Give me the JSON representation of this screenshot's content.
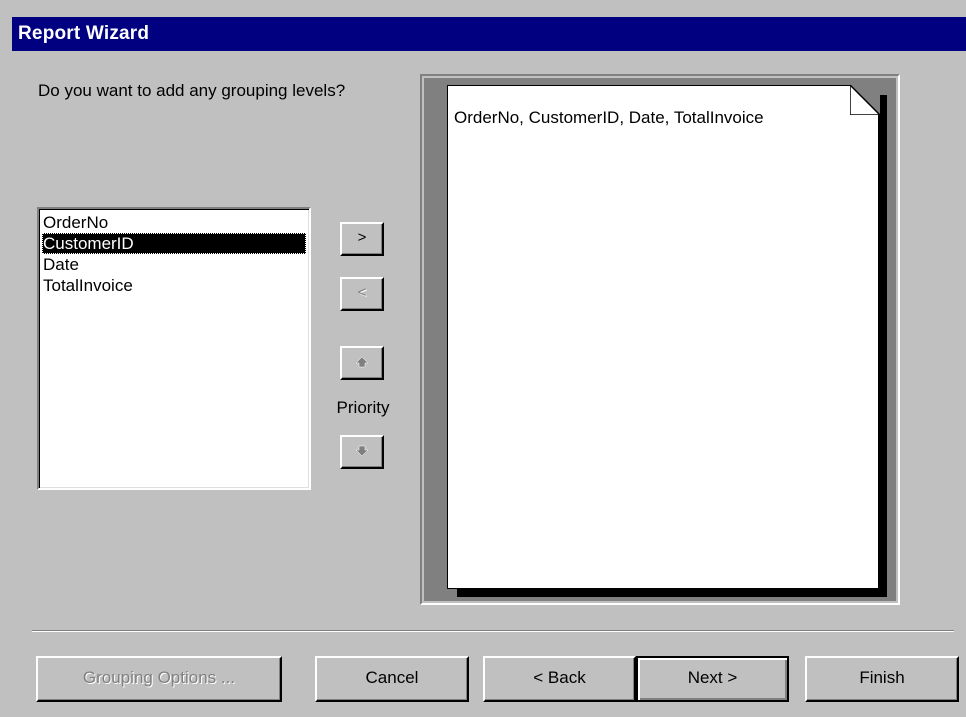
{
  "window": {
    "title": "Report Wizard"
  },
  "prompt": "Do you want to add any grouping levels?",
  "fields_list": {
    "items": [
      "OrderNo",
      "CustomerID",
      "Date",
      "TotalInvoice"
    ],
    "selected_index": 1
  },
  "move_buttons": {
    "add_label": ">",
    "remove_label": "<"
  },
  "priority": {
    "label": "Priority",
    "up_icon": "arrow-up-icon",
    "down_icon": "arrow-down-icon"
  },
  "preview": {
    "text": "OrderNo, CustomerID, Date, TotalInvoice"
  },
  "footer": {
    "grouping_options_label": "Grouping Options ...",
    "cancel_label": "Cancel",
    "back_label": "< Back",
    "next_label": "Next >",
    "finish_label": "Finish"
  },
  "colors": {
    "titlebar": "#000080",
    "face": "#c0c0c0",
    "selection": "#000000"
  }
}
